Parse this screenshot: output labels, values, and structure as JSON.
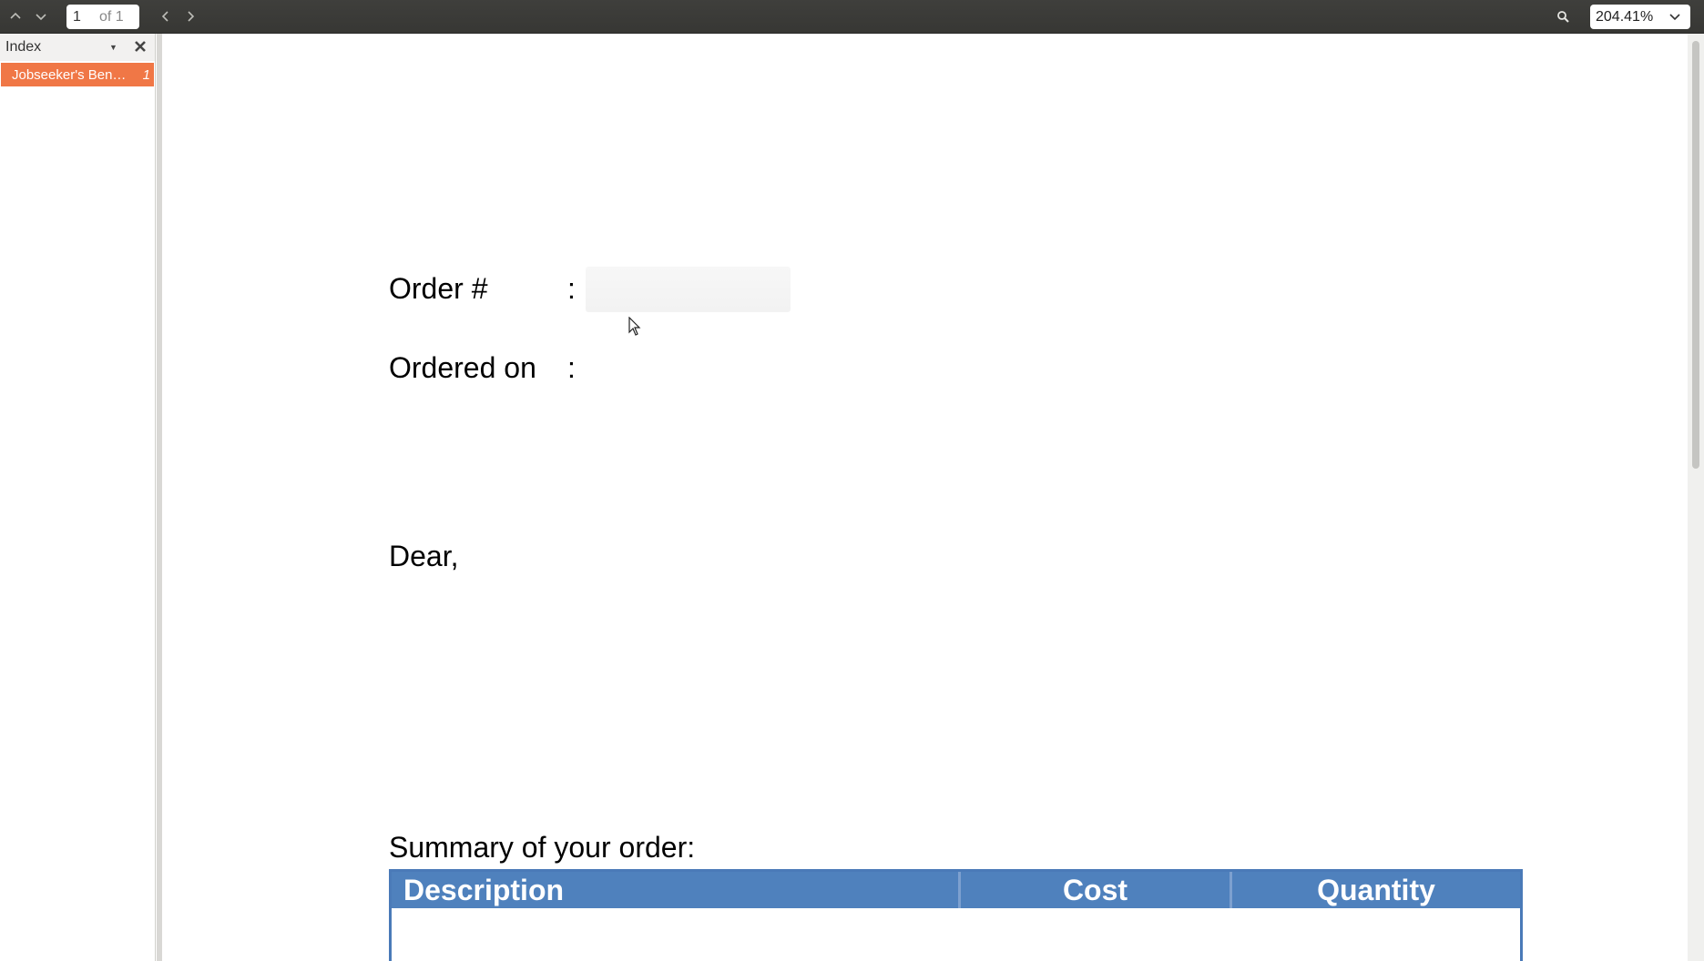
{
  "toolbar": {
    "page_current": "1",
    "page_total": "of 1",
    "zoom": "204.41%"
  },
  "sidebar": {
    "title": "Index",
    "items": [
      {
        "label": "Jobseeker's Ben…",
        "page": "1",
        "selected": true
      }
    ]
  },
  "document": {
    "order_label": "Order #",
    "order_colon": ":",
    "ordered_on_label": "Ordered on",
    "ordered_on_colon": ":",
    "greeting": "Dear,",
    "summary_heading": "Summary of your order:",
    "table": {
      "headers": [
        "Description",
        "Cost",
        "Quantity"
      ],
      "header_color": "#4f81bd"
    }
  },
  "colors": {
    "accent": "#f07746",
    "toolbar_bg": "#3b3b38"
  }
}
